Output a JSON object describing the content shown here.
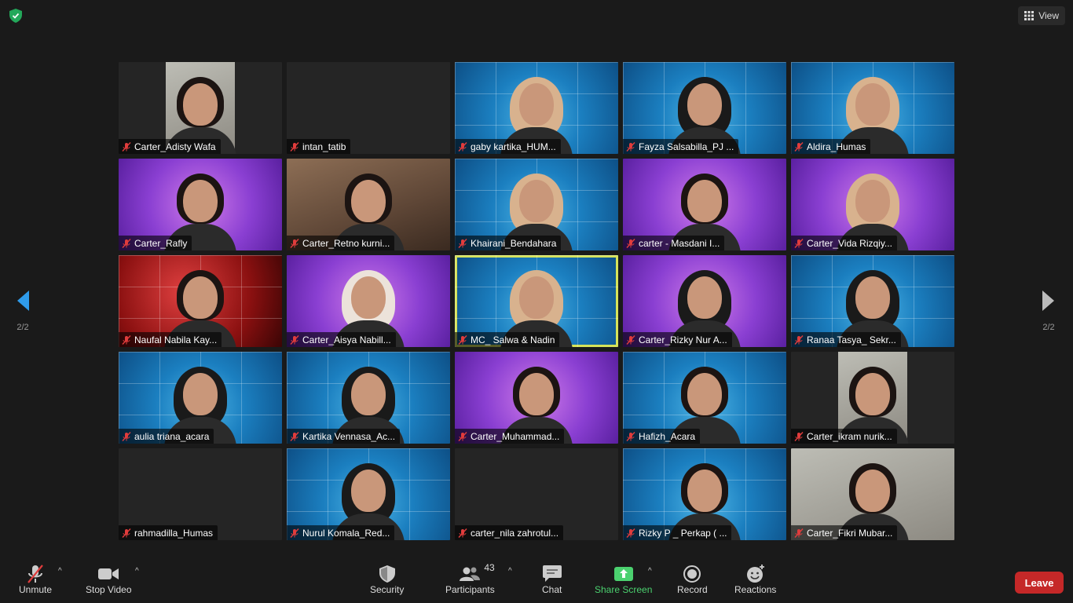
{
  "header": {
    "view_label": "View"
  },
  "pagination": {
    "left_page": "2/2",
    "right_page": "2/2"
  },
  "participants": [
    {
      "name": "Carter_Adisty Wafa",
      "bg": "portrait-room"
    },
    {
      "name": "intan_tatib",
      "bg": "none"
    },
    {
      "name": "gaby kartika_HUM...",
      "bg": "blue"
    },
    {
      "name": "Fayza Salsabilla_PJ ...",
      "bg": "blue"
    },
    {
      "name": "Aldira_Humas",
      "bg": "blue"
    },
    {
      "name": "Carter_Rafly",
      "bg": "purple"
    },
    {
      "name": "Carter_Retno kurni...",
      "bg": "room"
    },
    {
      "name": "Khairani_Bendahara",
      "bg": "blue"
    },
    {
      "name": "carter - Masdani I...",
      "bg": "purple"
    },
    {
      "name": "Carter_Vida Rizqiy...",
      "bg": "purple"
    },
    {
      "name": "Naufal Nabila Kay...",
      "bg": "red"
    },
    {
      "name": "Carter_Aisya Nabill...",
      "bg": "purple"
    },
    {
      "name": "MC_ Salwa & Nadin",
      "bg": "blue",
      "active": true
    },
    {
      "name": "Carter_Rizky Nur A...",
      "bg": "purple"
    },
    {
      "name": "Ranaa Tasya_ Sekr...",
      "bg": "blue"
    },
    {
      "name": "aulia triana_acara",
      "bg": "blue"
    },
    {
      "name": "Kartika Vennasa_Ac...",
      "bg": "blue"
    },
    {
      "name": "Carter_Muhammad...",
      "bg": "purple"
    },
    {
      "name": "Hafizh_Acara",
      "bg": "blue"
    },
    {
      "name": "Carter_ikram nurik...",
      "bg": "portrait-room"
    },
    {
      "name": "rahmadilla_Humas",
      "bg": "none"
    },
    {
      "name": "Nurul Komala_Red...",
      "bg": "blue"
    },
    {
      "name": "carter_nila zahrotul...",
      "bg": "none"
    },
    {
      "name": "Rizky P _ Perkap ( ...",
      "bg": "blue"
    },
    {
      "name": "Carter_Fikri Mubar...",
      "bg": "grey"
    }
  ],
  "toolbar": {
    "unmute": "Unmute",
    "stop_video": "Stop Video",
    "security": "Security",
    "participants": "Participants",
    "participants_count": "43",
    "chat": "Chat",
    "share_screen": "Share Screen",
    "record": "Record",
    "reactions": "Reactions",
    "leave": "Leave"
  },
  "colors": {
    "leave": "#c52828",
    "share": "#4bd16f",
    "active_speaker": "#d6e35a",
    "security_shield": "#23a85a"
  }
}
